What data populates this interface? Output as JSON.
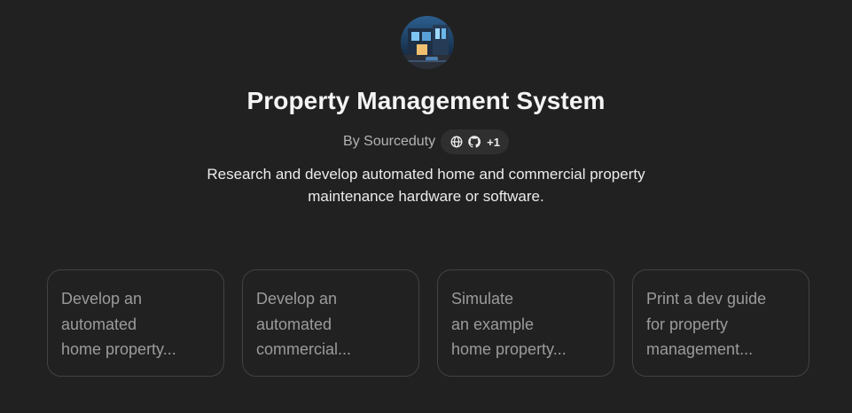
{
  "gpt": {
    "title": "Property Management System",
    "byline": "By Sourceduty",
    "links_more": "+1",
    "description": "Research and develop automated home and commercial property maintenance hardware or software."
  },
  "links": {
    "icons": [
      "globe-icon",
      "github-icon"
    ]
  },
  "conversation_starters": [
    {
      "label": "Develop an\nautomated\nhome property..."
    },
    {
      "label": "Develop an\nautomated\ncommercial..."
    },
    {
      "label": "Simulate\nan example\nhome property..."
    },
    {
      "label": "Print a dev guide\nfor property\nmanagement..."
    }
  ],
  "colors": {
    "background": "#212121",
    "title": "#f4f4f4",
    "muted": "#b4b4b4",
    "starter_text": "#9b9b9b",
    "starter_border": "#424242",
    "pill": "#2f2f2f"
  }
}
